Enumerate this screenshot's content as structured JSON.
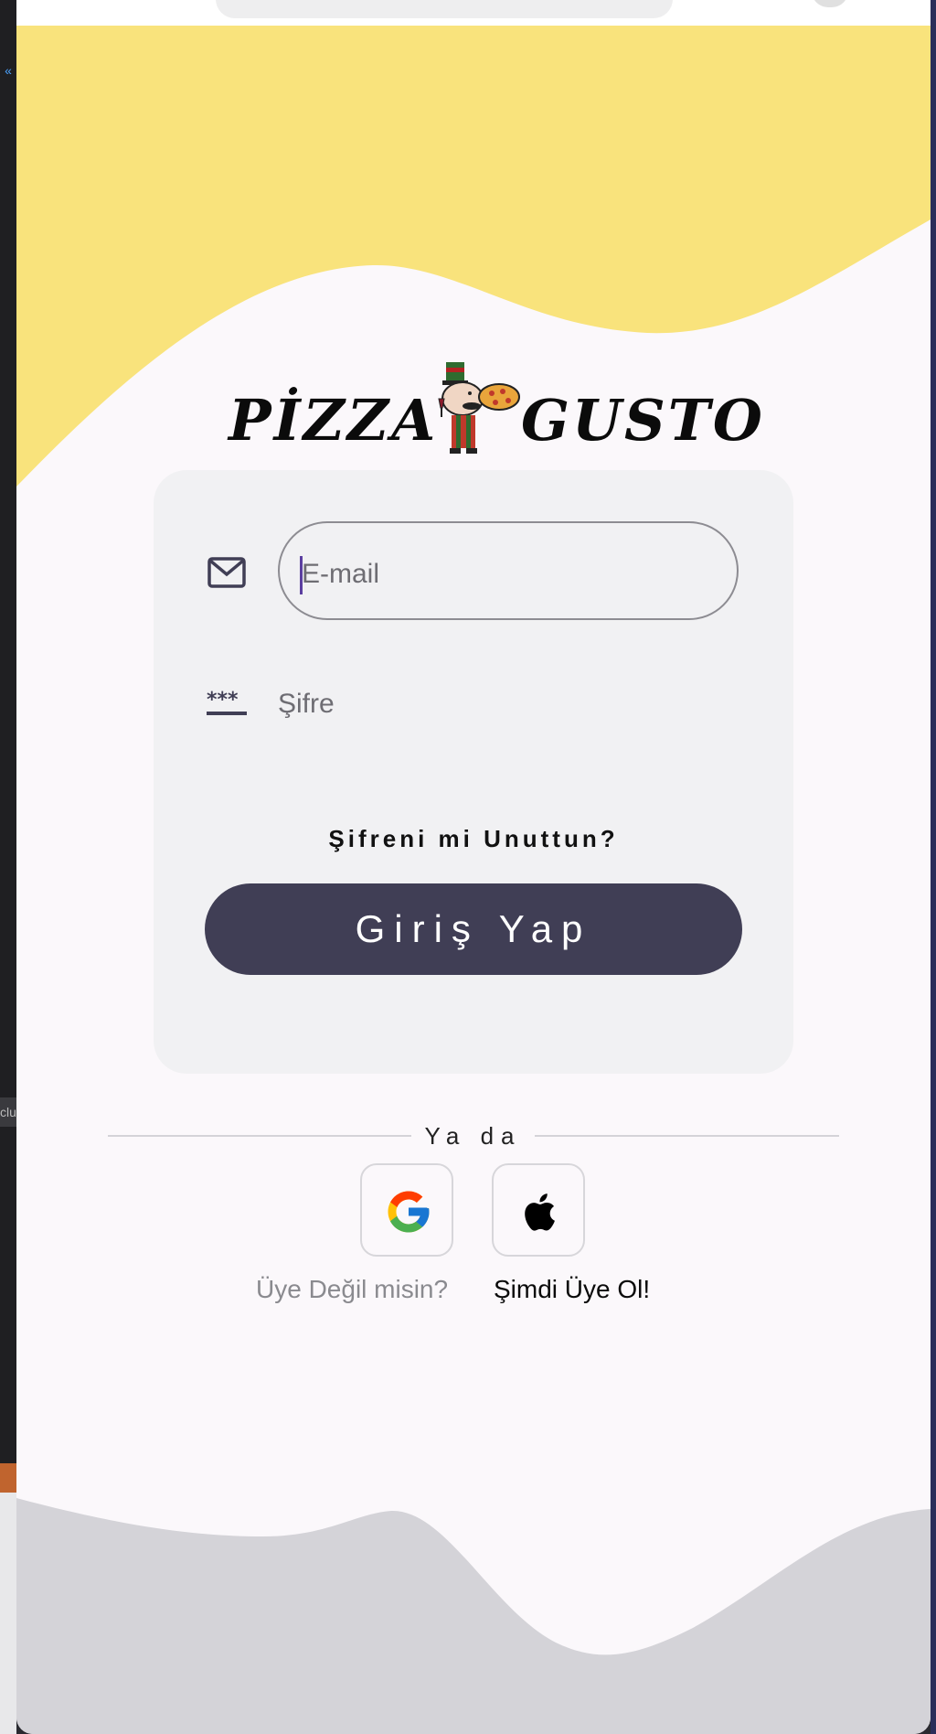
{
  "app": {
    "brand_left": "PİZZA",
    "brand_right": "GUSTO"
  },
  "login": {
    "email_placeholder": "E-mail",
    "password_placeholder": "Şifre",
    "forgot_label": "Şifreni mi Unuttun?",
    "submit_label": "Giriş Yap"
  },
  "divider": {
    "label": "Ya da"
  },
  "social": {
    "google_icon": "google-icon",
    "apple_icon": "apple-icon"
  },
  "signup": {
    "prompt": "Üye Değil misin?",
    "link_label": "Şimdi Üye Ol!"
  },
  "editor_side": {
    "partial_label": "clu"
  },
  "colors": {
    "top_wave": "#f9e37c",
    "bottom_wave": "#d4d3d8",
    "background": "#fbf8fb",
    "card": "#f1f1f3",
    "primary_button": "#403e55",
    "caret": "#5b3fa0"
  }
}
